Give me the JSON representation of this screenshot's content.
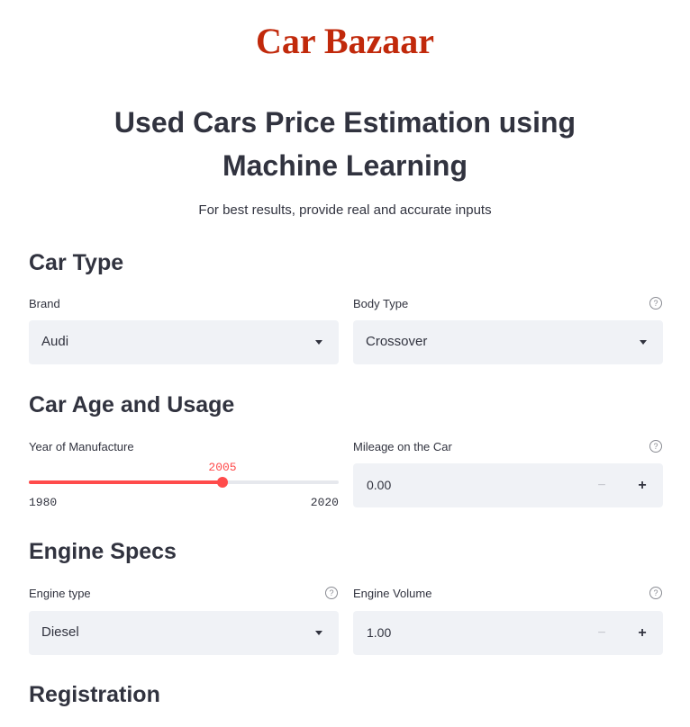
{
  "header": {
    "brand": "Car Bazaar",
    "title": "Used Cars Price Estimation using Machine Learning",
    "subtitle": "For best results, provide real and accurate inputs"
  },
  "sections": {
    "car_type": "Car Type",
    "age_usage": "Car Age and Usage",
    "engine_specs": "Engine Specs",
    "registration": "Registration"
  },
  "fields": {
    "brand": {
      "label": "Brand",
      "value": "Audi"
    },
    "body_type": {
      "label": "Body Type",
      "value": "Crossover"
    },
    "year": {
      "label": "Year of Manufacture",
      "value": "2005",
      "min": "1980",
      "max": "2020",
      "fraction": 0.625
    },
    "mileage": {
      "label": "Mileage on the Car",
      "value": "0.00"
    },
    "engine_type": {
      "label": "Engine type",
      "value": "Diesel"
    },
    "engine_volume": {
      "label": "Engine Volume",
      "value": "1.00"
    }
  },
  "icons": {
    "help": "question-circle-icon",
    "dropdown": "chevron-down-icon",
    "minus": "minus-icon",
    "plus": "plus-icon"
  },
  "symbols": {
    "help": "?",
    "minus": "−",
    "plus": "+"
  },
  "colors": {
    "brand": "#c1290b",
    "accent": "#ff4b4b",
    "input_bg": "#f0f2f6",
    "text": "#31333f"
  }
}
